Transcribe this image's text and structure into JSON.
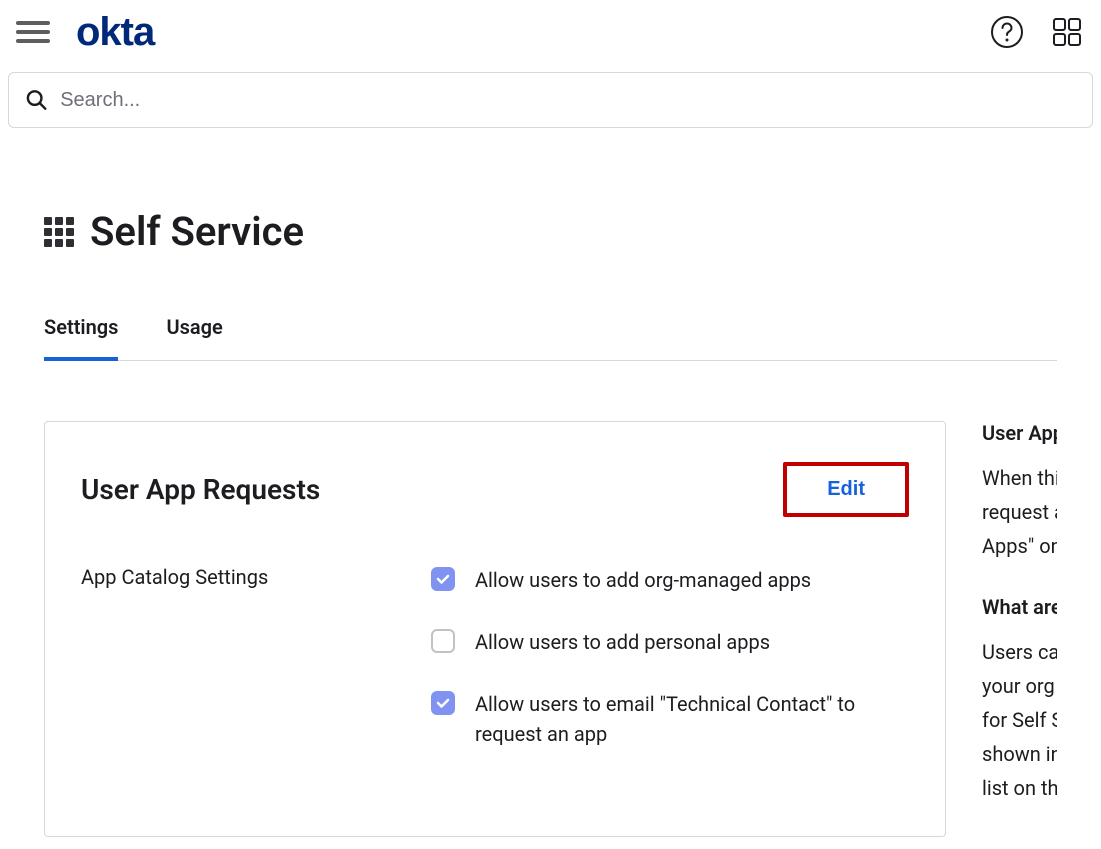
{
  "brand": "okta",
  "search": {
    "placeholder": "Search..."
  },
  "page": {
    "title": "Self Service",
    "tabs": [
      {
        "label": "Settings",
        "active": true
      },
      {
        "label": "Usage",
        "active": false
      }
    ]
  },
  "card": {
    "title": "User App Requests",
    "edit_label": "Edit",
    "section_label": "App Catalog Settings",
    "checkboxes": [
      {
        "label": "Allow users to add org-managed apps",
        "checked": true
      },
      {
        "label": "Allow users to add personal apps",
        "checked": false
      },
      {
        "label": "Allow users to email \"Technical Contact\" to request an app",
        "checked": true
      }
    ]
  },
  "help": {
    "h1": "User App Re",
    "p1a": "When this is",
    "p1b": "request apps",
    "p1c": "Apps\" on the",
    "h2": "What are or",
    "p2a": "Users can re",
    "p2b": "your org has",
    "p2c": "for Self Serv",
    "p2d": "shown in the",
    "p2e": "list on the le"
  }
}
